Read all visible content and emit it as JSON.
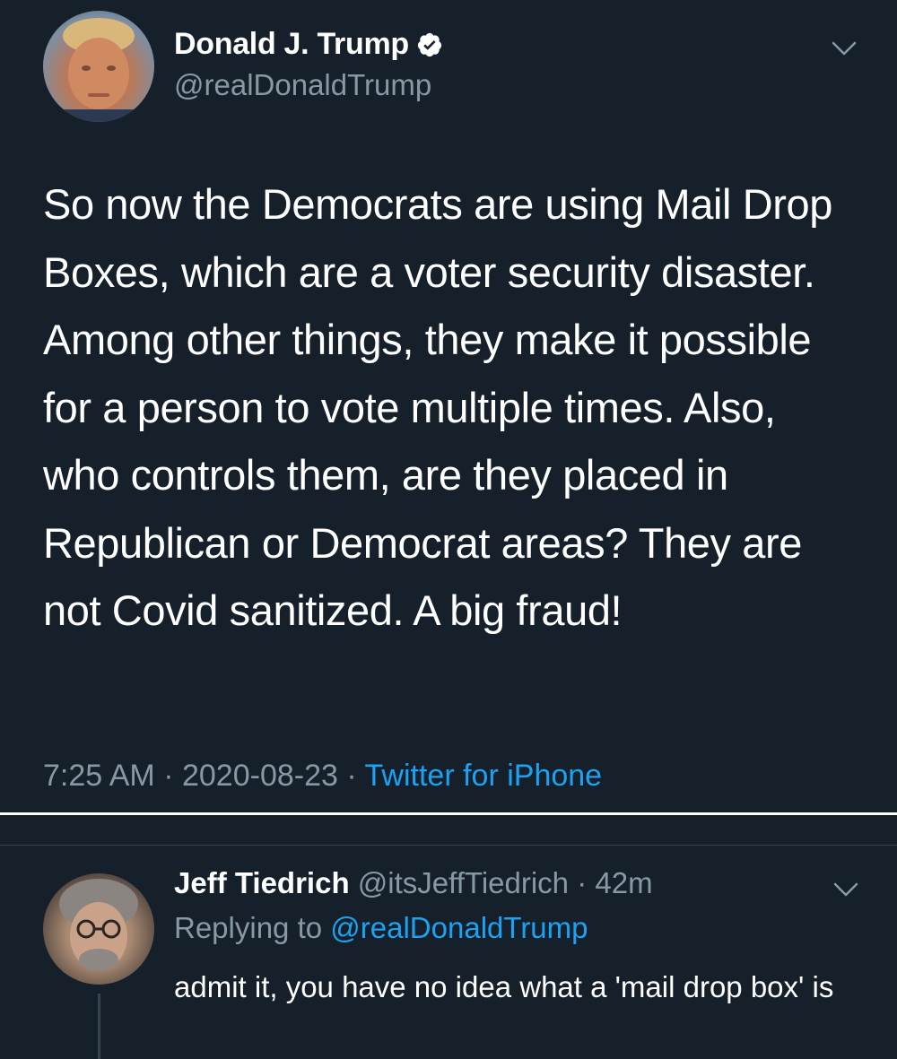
{
  "tweet": {
    "author": {
      "display_name": "Donald J. Trump",
      "handle": "@realDonaldTrump",
      "verified": true
    },
    "text": "So now the Democrats are using Mail Drop Boxes, which are a voter security disaster. Among other things, they make it possible for a person to vote multiple times. Also, who controls them, are they placed in Republican or Democrat areas? They are not Covid sanitized. A big fraud!",
    "time": "7:25 AM",
    "date": "2020-08-23",
    "separator": "·",
    "source": "Twitter for iPhone"
  },
  "reply": {
    "author": {
      "display_name": "Jeff Tiedrich",
      "handle": "@itsJeffTiedrich"
    },
    "separator": "·",
    "time_ago": "42m",
    "replying_to_label": "Replying to",
    "replying_to_handle": "@realDonaldTrump",
    "text": "admit it, you have no idea what a 'mail drop box' is"
  },
  "colors": {
    "background": "#15202b",
    "primary_text": "#ffffff",
    "secondary_text": "#8899a6",
    "link": "#1da1f2",
    "divider": "#38444d"
  },
  "icons": {
    "verified": "verified-badge-icon",
    "more": "chevron-down-icon"
  }
}
